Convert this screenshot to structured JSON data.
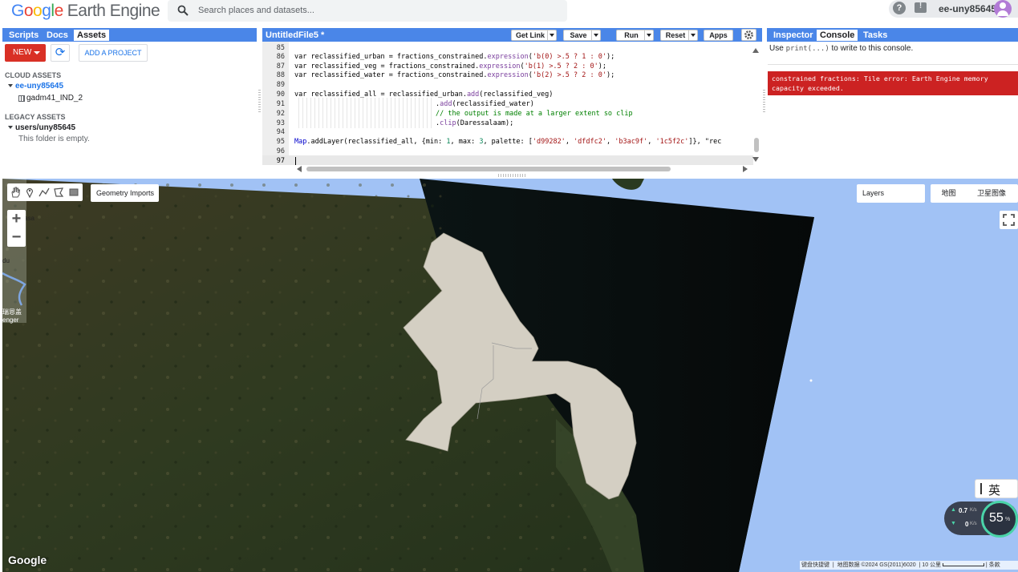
{
  "app": {
    "logo_google": [
      "G",
      "o",
      "o",
      "g",
      "l",
      "e"
    ],
    "logo_product": "Earth Engine",
    "search_placeholder": "Search places and datasets...",
    "username": "ee-uny85645"
  },
  "left_panel": {
    "tabs": [
      "Scripts",
      "Docs",
      "Assets"
    ],
    "active_tab": "Assets",
    "new_label": "NEW",
    "add_project_label": "ADD A PROJECT",
    "cloud_assets_label": "CLOUD ASSETS",
    "cloud_project": "ee-uny85645",
    "cloud_asset": "gadm41_IND_2",
    "legacy_assets_label": "LEGACY ASSETS",
    "legacy_folder": "users/uny85645",
    "legacy_empty": "This folder is empty."
  },
  "editor": {
    "title": "UntitledFile5 *",
    "buttons": {
      "get_link": "Get Link",
      "save": "Save",
      "run": "Run",
      "reset": "Reset",
      "apps": "Apps"
    },
    "line_numbers": [
      "85",
      "86",
      "87",
      "88",
      "89",
      "90",
      "91",
      "92",
      "93",
      "94",
      "95",
      "96",
      "97"
    ],
    "lines": {
      "l86": [
        "var reclassified_urban = fractions_constrained.",
        "expression",
        "(",
        "'b(0) >.5 ? 1 : 0'",
        ");"
      ],
      "l87": [
        "var reclassified_veg = fractions_constrained.",
        "expression",
        "(",
        "'b(1) >.5 ? 2 : 0'",
        ");"
      ],
      "l88": [
        "var reclassified_water = fractions_constrained.",
        "expression",
        "(",
        "'b(2) >.5 ? 2 : 0'",
        ");"
      ],
      "l90": [
        "var reclassified_all = reclassified_urban.",
        "add",
        "(reclassified_veg)"
      ],
      "l91": [
        ".",
        "add",
        "(reclassified_water)"
      ],
      "l92": "// the output is made at a larger extent so clip",
      "l93": [
        ".",
        "clip",
        "(Daressalaam);"
      ],
      "l95": {
        "obj": "Map",
        "method": ".addLayer",
        "open": "(reclassified_all, {min: ",
        "min": "1",
        "mid": ", max: ",
        "max": "3",
        "pal": ", palette: [",
        "c1": "'d99282'",
        "c2": "'dfdfc2'",
        "c3": "'b3ac9f'",
        "c4": "'1c5f2c'",
        "tail": "]}, \"rec"
      },
      "sep": ", "
    }
  },
  "right_panel": {
    "tabs": [
      "Inspector",
      "Console",
      "Tasks"
    ],
    "active_tab": "Console",
    "hint_prefix": "Use ",
    "hint_code": "print(...)",
    "hint_suffix": " to write to this console.",
    "error_line1": "constrained fractions: Tile error: Earth Engine memory",
    "error_line2": "capacity exceeded."
  },
  "map": {
    "geometry_imports": "Geometry Imports",
    "layers": "Layers",
    "map_type_map": "地图",
    "map_type_satellite": "卫星图像",
    "zoom_in": "+",
    "zoom_out": "−",
    "ime_char": "英",
    "net_up": "0.7",
    "net_down": "0",
    "net_unit": "K/s",
    "net_percent": "55",
    "net_percent_unit": "%",
    "attribution_1": "键盘快捷键",
    "attribution_2": "地图数据 ©2024 GS(2011)6020",
    "attribution_3": "10 公里",
    "attribution_4": "条款",
    "google_logo": "Google",
    "edge_labels": [
      "asa",
      "du",
      "瑞恩盖",
      "enger"
    ]
  },
  "colors": {
    "header_blue": "#4a86e8",
    "new_red": "#d93025",
    "error_red": "#cc2222",
    "ocean": "#a1c2f5",
    "region_fill": "#d4cfc3"
  }
}
